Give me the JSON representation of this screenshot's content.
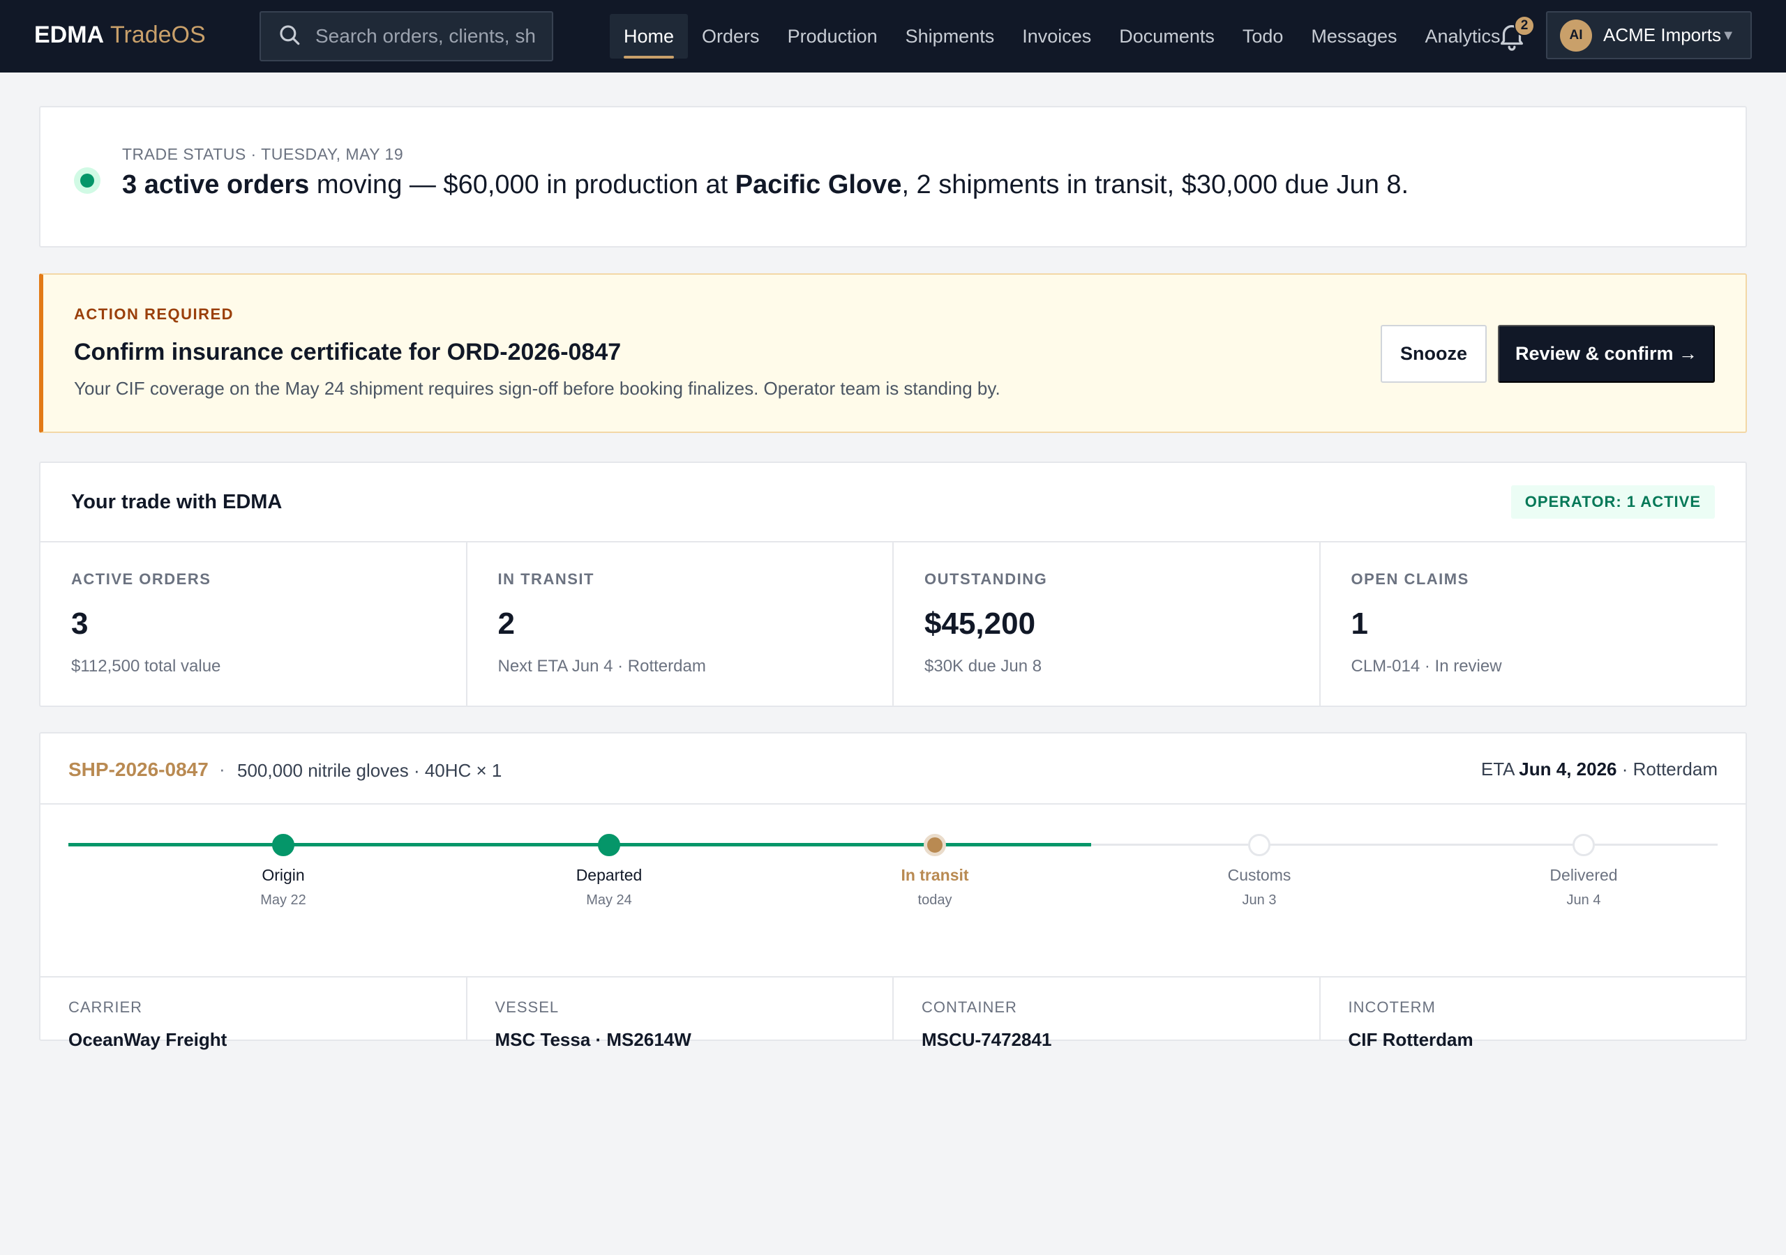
{
  "app": {
    "brand_primary": "EDMA",
    "brand_secondary": "TradeOS",
    "accent_color": "#c9a06a"
  },
  "search": {
    "placeholder": "Search orders, clients, sh",
    "value": ""
  },
  "nav": {
    "items": [
      {
        "label": "Home",
        "active": true
      },
      {
        "label": "Orders",
        "active": false
      },
      {
        "label": "Production",
        "active": false
      },
      {
        "label": "Shipments",
        "active": false
      },
      {
        "label": "Invoices",
        "active": false
      },
      {
        "label": "Documents",
        "active": false
      },
      {
        "label": "Todo",
        "active": false
      },
      {
        "label": "Messages",
        "active": false
      },
      {
        "label": "Analytics",
        "active": false
      }
    ]
  },
  "notifications": {
    "icon": "bell-icon",
    "count": "2"
  },
  "account": {
    "initials": "AI",
    "name": "ACME Imports",
    "caret": "▼"
  },
  "status": {
    "eyebrow": "TRADE STATUS · TUESDAY, MAY 19",
    "bold_1": "3 active orders",
    "text_1": " moving — $60,000 in production at ",
    "bold_2": "Pacific Glove",
    "text_2": ", 2 shipments in transit, $30,000 due Jun 8.",
    "indicator_color": "#059669"
  },
  "action": {
    "eyebrow": "ACTION REQUIRED",
    "title": "Confirm insurance certificate for ORD-2026-0847",
    "description": "Your CIF coverage on the May 24 shipment requires sign-off before booking finalizes. Operator team is standing by.",
    "snooze_label": "Snooze",
    "review_label": "Review & confirm →",
    "accent_color": "#e27a17"
  },
  "trade": {
    "title": "Your trade with EDMA",
    "operator_badge": "OPERATOR: 1 ACTIVE",
    "stats": [
      {
        "label": "ACTIVE ORDERS",
        "value": "3",
        "sub": "$112,500 total value"
      },
      {
        "label": "IN TRANSIT",
        "value": "2",
        "sub": "Next ETA Jun 4 · Rotterdam"
      },
      {
        "label": "OUTSTANDING",
        "value": "$45,200",
        "sub": "$30K due Jun 8"
      },
      {
        "label": "OPEN CLAIMS",
        "value": "1",
        "sub": "CLM-014 · In review"
      }
    ]
  },
  "shipment": {
    "id": "SHP-2026-0847",
    "separator": "·",
    "description": "500,000 nitrile gloves · 40HC × 1",
    "eta_prefix": "ETA ",
    "eta_date": "Jun 4, 2026",
    "eta_suffix": " · Rotterdam",
    "progress_fraction": 0.62,
    "timeline": [
      {
        "label": "Origin",
        "date": "May 22",
        "state": "done"
      },
      {
        "label": "Departed",
        "date": "May 24",
        "state": "done"
      },
      {
        "label": "In transit",
        "date": "today",
        "state": "current"
      },
      {
        "label": "Customs",
        "date": "Jun 3",
        "state": "pending"
      },
      {
        "label": "Delivered",
        "date": "Jun 4",
        "state": "pending"
      }
    ],
    "meta": [
      {
        "label": "CARRIER",
        "value": "OceanWay Freight"
      },
      {
        "label": "VESSEL",
        "value": "MSC Tessa · MS2614W"
      },
      {
        "label": "CONTAINER",
        "value": "MSCU-7472841"
      },
      {
        "label": "INCOTERM",
        "value": "CIF Rotterdam"
      }
    ]
  }
}
